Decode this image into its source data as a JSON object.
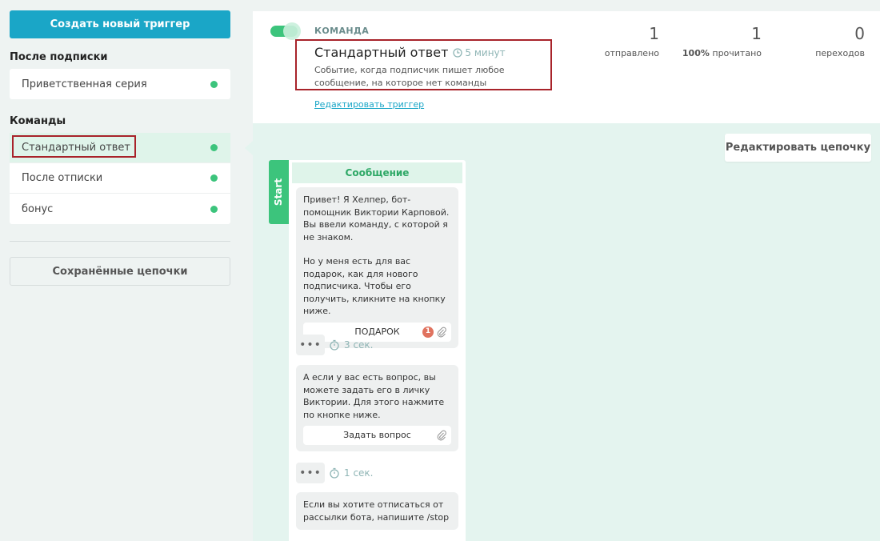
{
  "sidebar": {
    "create_label": "Создать новый триггер",
    "after_subscribe_title": "После подписки",
    "after_subscribe_items": [
      {
        "label": "Приветственная серия",
        "status": "active"
      }
    ],
    "commands_title": "Команды",
    "command_items": [
      {
        "label": "Стандартный ответ",
        "status": "active",
        "selected": true
      },
      {
        "label": "После отписки",
        "status": "active"
      },
      {
        "label": "бонус",
        "status": "active"
      }
    ],
    "saved_chains_label": "Сохранённые цепочки"
  },
  "trigger": {
    "kind": "КОМАНДА",
    "enabled": true,
    "title": "Стандартный ответ",
    "delay": "5 минут",
    "description": "Событие, когда подписчик пишет любое сообщение, на которое нет команды",
    "edit_label": "Редактировать триггер"
  },
  "stats": {
    "sent_value": "1",
    "sent_label": "отправлено",
    "read_value": "1",
    "read_percent": "100%",
    "read_label": "прочитано",
    "clicks_value": "0",
    "clicks_label": "переходов"
  },
  "edit_chain_label": "Редактировать цепочку",
  "flow": {
    "start_label": "Start",
    "header": "Сообщение",
    "message1_p1": "Привет! Я Хелпер, бот-помощник Виктории Карповой. Вы ввели команду, с которой я не знаком.",
    "message1_p2": "Но у меня есть для вас подарок, как для нового подписчика. Чтобы его получить, кликните на кнопку ниже.",
    "button1_label": "ПОДАРОК",
    "button1_badge": "1",
    "delay1": "3 сек.",
    "message2": "А если у вас есть вопрос, вы можете задать его в личку Виктории. Для этого нажмите по кнопке ниже.",
    "button2_label": "Задать вопрос",
    "delay2": "1 сек.",
    "message3": "Если вы хотите отписаться от рассылки бота, напишите /stop",
    "dots_label": "•••"
  },
  "colors": {
    "accent": "#1aa6c7",
    "active_dot": "#3cc47c",
    "highlight": "#a8232a",
    "badge": "#e0735f"
  }
}
